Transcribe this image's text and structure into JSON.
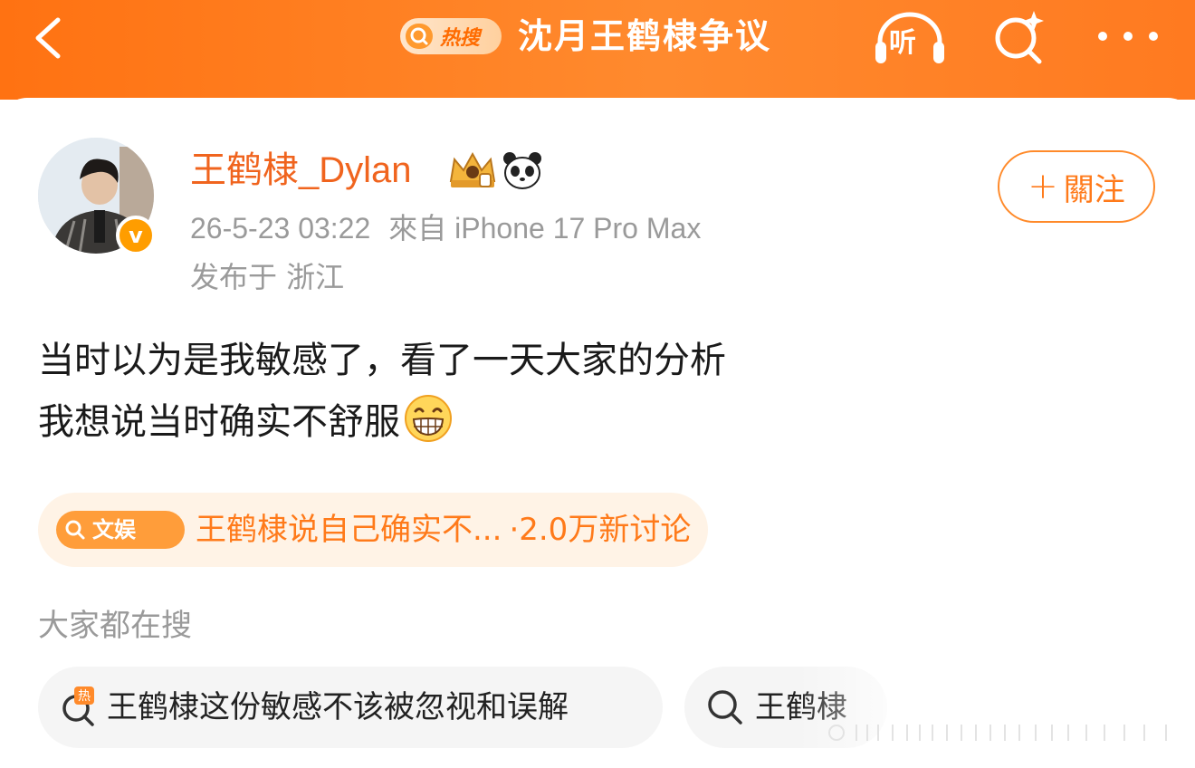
{
  "topbar": {
    "hot_badge": "热搜",
    "topic_title": "沈月王鹤棣争议",
    "listen_label": "听",
    "accent": "#ff7a1a"
  },
  "post": {
    "username": "王鹤棣_Dylan",
    "timestamp": "26-5-23 03:22",
    "source": "來自 iPhone 17 Pro Max",
    "location": "发布于 浙江",
    "follow_label": "關注",
    "text_line1": "当时以为是我敏感了，看了一天大家的分析",
    "text_line2": "我想说当时确实不舒服",
    "emoji": "grinning-face-icon"
  },
  "topic_chip": {
    "tag": "文娱",
    "text": "王鹤棣说自己确实不...",
    "count": "·2.0万新讨论"
  },
  "search_section": {
    "title": "大家都在搜",
    "items": [
      {
        "icon": "hot-search-icon",
        "label": "王鹤棣这份敏感不该被忽视和误解"
      },
      {
        "icon": "search-icon",
        "label": "王鹤棣"
      }
    ]
  }
}
